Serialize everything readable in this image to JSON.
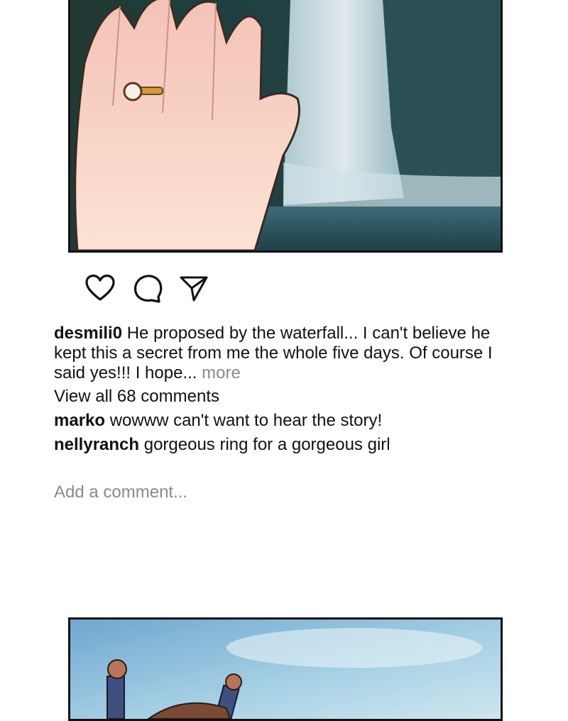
{
  "post": {
    "username": "desmili0",
    "caption_text": "He proposed by the waterfall... I can't believe he kept this a secret from me the whole five days. Of course I said yes!!! I hope...",
    "more_label": "more",
    "view_all_comments": "View all 68 comments",
    "comments": [
      {
        "user": "marko",
        "text": "wowww can't want to hear the story!"
      },
      {
        "user": "nellyranch",
        "text": "gorgeous ring for a gorgeous girl"
      }
    ],
    "add_comment_placeholder": "Add a comment..."
  },
  "icons": {
    "like": "heart-icon",
    "comment": "speech-bubble-icon",
    "share": "paper-plane-icon"
  },
  "colors": {
    "muted_text": "#8a8a8a",
    "border": "#111111",
    "water": "#2f5966",
    "sky": "#8fc3e0"
  }
}
